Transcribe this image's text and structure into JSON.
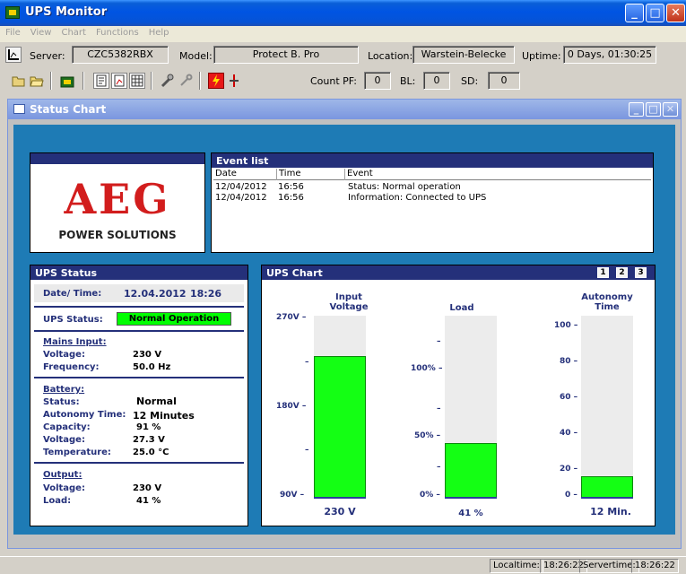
{
  "window": {
    "title": "UPS Monitor"
  },
  "menu": [
    "File",
    "View",
    "Chart",
    "Functions",
    "Help"
  ],
  "info": {
    "server_label": "Server:",
    "server": "CZC5382RBX",
    "model_label": "Model:",
    "model": "Protect B. Pro",
    "location_label": "Location:",
    "location": "Warstein-Belecke",
    "uptime_label": "Uptime:",
    "uptime": "0 Days, 01:30:25"
  },
  "counters": {
    "pf_label": "Count PF:",
    "pf": "0",
    "bl_label": "BL:",
    "bl": "0",
    "sd_label": "SD:",
    "sd": "0"
  },
  "child": {
    "title": "Status Chart"
  },
  "logo": {
    "brand": "AEG",
    "sub": "POWER SOLUTIONS"
  },
  "events": {
    "title": "Event list",
    "columns": [
      "Date",
      "Time",
      "Event"
    ],
    "rows": [
      {
        "date": "12/04/2012",
        "time": "16:56",
        "event": "Status: Normal operation"
      },
      {
        "date": "12/04/2012",
        "time": "16:56",
        "event": "Information: Connected to UPS"
      }
    ]
  },
  "status": {
    "title": "UPS Status",
    "date_label": "Date/ Time:",
    "date": "12.04.2012",
    "time": "18:26",
    "ups_status_label": "UPS Status:",
    "ups_status": "Normal Operation",
    "mains_heading": "Mains Input:",
    "mains_voltage_label": "Voltage:",
    "mains_voltage": "230 V",
    "frequency_label": "Frequency:",
    "frequency": "50.0 Hz",
    "battery_heading": "Battery:",
    "bat_status_label": "Status:",
    "bat_status": "Normal",
    "autonomy_label": "Autonomy Time:",
    "autonomy": "12 Minutes",
    "capacity_label": "Capacity:",
    "capacity": "91 %",
    "bat_voltage_label": "Voltage:",
    "bat_voltage": "27.3 V",
    "temperature_label": "Temperature:",
    "temperature": "25.0 °C",
    "output_heading": "Output:",
    "out_voltage_label": "Voltage:",
    "out_voltage": "230 V",
    "load_label": "Load:",
    "load": "41 %"
  },
  "chart": {
    "title": "UPS Chart",
    "pages": [
      "1",
      "2",
      "3"
    ],
    "input_title_1": "Input",
    "input_title_2": "Voltage",
    "load_title": "Load",
    "autonomy_title_1": "Autonomy",
    "autonomy_title_2": "Time",
    "input_ticks": [
      "270V",
      "180V",
      "90V"
    ],
    "load_ticks": [
      "100%",
      "50%",
      "0%"
    ],
    "autonomy_ticks": [
      "100",
      "80",
      "60",
      "40",
      "20",
      "0"
    ],
    "input_value": "230 V",
    "load_value": "41 %",
    "autonomy_value": "12 Min."
  },
  "chart_data": {
    "type": "bar",
    "categories": [
      "Input Voltage",
      "Load",
      "Autonomy Time"
    ],
    "values": [
      230,
      41,
      12
    ],
    "ylim": [
      [
        90,
        270
      ],
      [
        0,
        100
      ],
      [
        0,
        100
      ]
    ],
    "colors": {
      "fill": "#14ff14",
      "header": "#24307a"
    }
  },
  "statusbar": {
    "localtime_label": "Localtime:",
    "localtime": "18:26:22",
    "servertime_label": "Servertime:",
    "servertime": "18:26:22"
  }
}
